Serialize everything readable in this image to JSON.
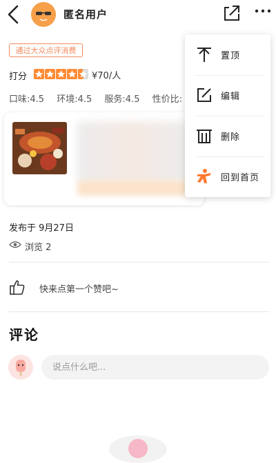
{
  "header": {
    "username": "匿名用户",
    "back_icon": "back-arrow-icon",
    "share_icon": "share-icon",
    "more_icon": "more-dots-icon"
  },
  "review": {
    "badge": "通过大众点评消费",
    "score_label": "打分",
    "rating": 4.5,
    "rating_max": 5,
    "price": "¥70/人",
    "subscores": [
      "口味:4.5",
      "环境:4.5",
      "服务:4.5",
      "性价比:"
    ]
  },
  "meta": {
    "published": "发布于 9月27日",
    "views": "浏览 2"
  },
  "like": {
    "text": "快来点第一个赞吧~"
  },
  "comments": {
    "title": "评论",
    "placeholder": "说点什么吧..."
  },
  "menu": {
    "items": [
      {
        "label": "置顶",
        "icon": "pin-top-icon"
      },
      {
        "label": "编辑",
        "icon": "edit-icon"
      },
      {
        "label": "删除",
        "icon": "trash-icon"
      },
      {
        "label": "回到首页",
        "icon": "home-mascot-icon"
      }
    ]
  },
  "colors": {
    "accent": "#ff8a34",
    "badge": "#f08a5d",
    "mascot": "#ff7a2e"
  }
}
